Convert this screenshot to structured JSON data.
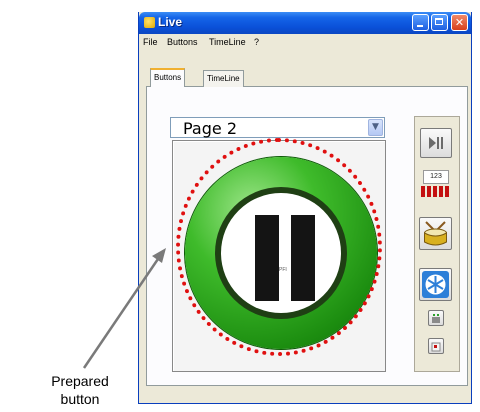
{
  "window": {
    "title": "Live"
  },
  "menu": {
    "items": [
      "File",
      "Buttons",
      "TimeLine",
      "?"
    ]
  },
  "tabs": [
    {
      "label": "Buttons",
      "active": true
    },
    {
      "label": "TimeLine",
      "active": false
    }
  ],
  "page_select": {
    "value": "Page 2"
  },
  "big_button": {
    "caption": "PFI",
    "icon": "pause-icon",
    "color": "#2aa51c"
  },
  "side_toolbar": {
    "play_pause_icon": "play-pause-icon",
    "counter": "123",
    "meter_icon": "level-meter-icon",
    "drum_icon": "drum-icon",
    "snowflake_icon": "snowflake-icon"
  },
  "annotation": {
    "line1": "Prepared",
    "line2": "button",
    "highlight_color": "#e01010"
  }
}
